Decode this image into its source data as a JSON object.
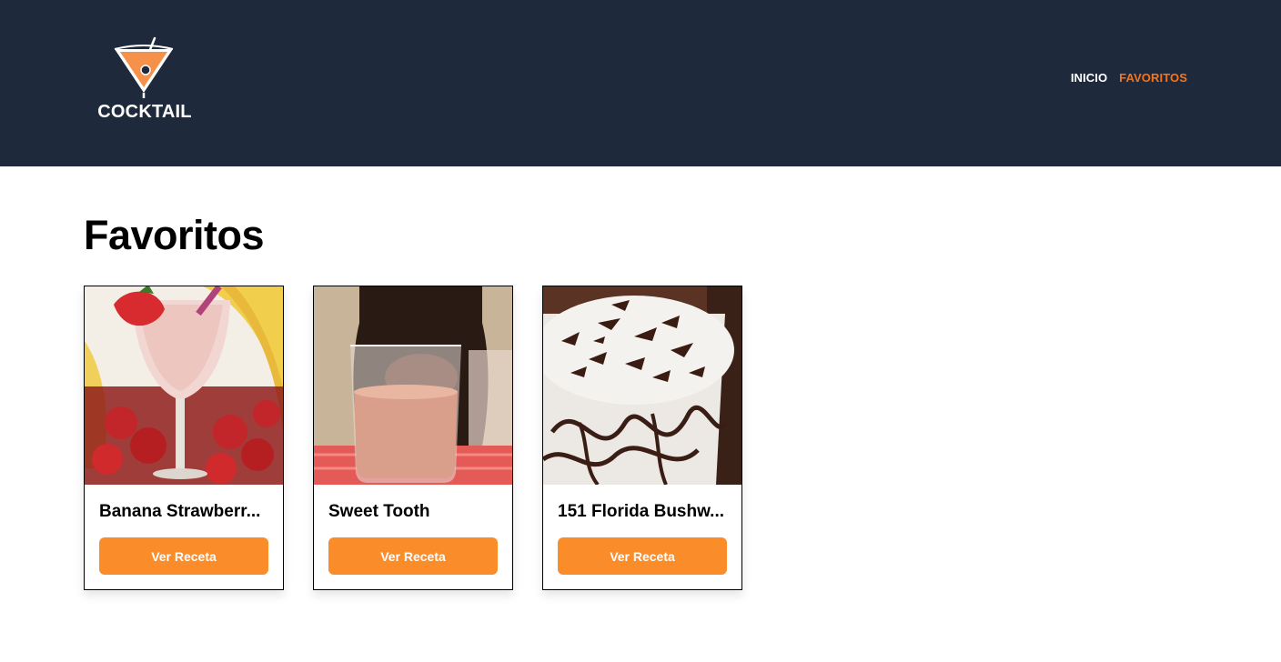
{
  "brand": {
    "logo_text": "COCKTAIL"
  },
  "nav": {
    "items": [
      {
        "label": "INICIO"
      },
      {
        "label": "FAVORITOS"
      }
    ]
  },
  "main": {
    "title": "Favoritos",
    "cards": [
      {
        "name": "Banana Strawberr...",
        "button_label": "Ver Receta"
      },
      {
        "name": "Sweet Tooth",
        "button_label": "Ver Receta"
      },
      {
        "name": "151 Florida Bushw...",
        "button_label": "Ver Receta"
      }
    ]
  },
  "colors": {
    "header_bg": "#1e293b",
    "accent": "#f97316",
    "button_bg": "#fb8c2a"
  }
}
